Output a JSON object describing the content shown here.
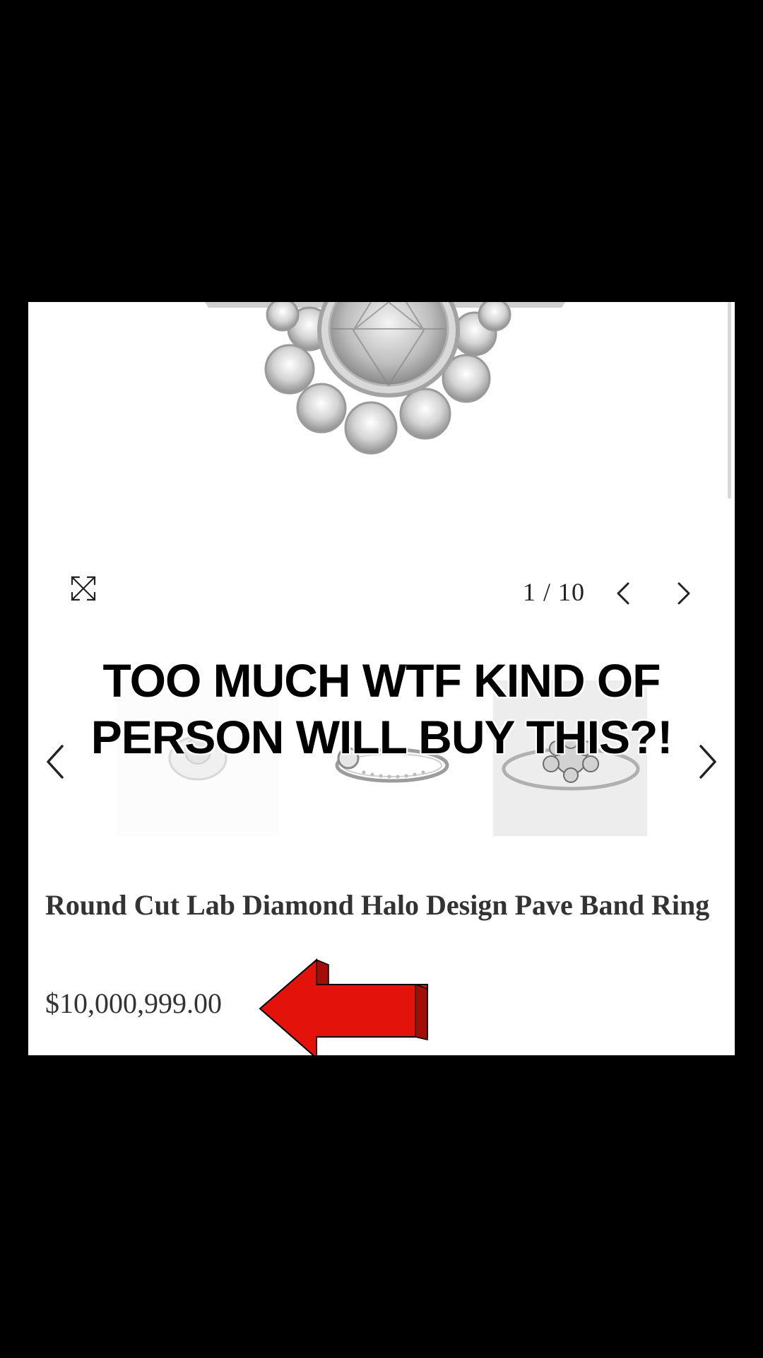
{
  "gallery": {
    "counter": "1 / 10",
    "expand_icon": "expand-icon",
    "prev_icon": "chevron-left-icon",
    "next_icon": "chevron-right-icon"
  },
  "overlay": {
    "line1": "TOO MUCH WTF KIND OF",
    "line2": "PERSON WILL BUY THIS?!"
  },
  "product": {
    "title": "Round Cut Lab Diamond Halo Design Pave Band Ring",
    "price": "$10,000,999.00"
  },
  "colors": {
    "arrow_red": "#e3120b",
    "background": "#000000",
    "card": "#ffffff"
  }
}
